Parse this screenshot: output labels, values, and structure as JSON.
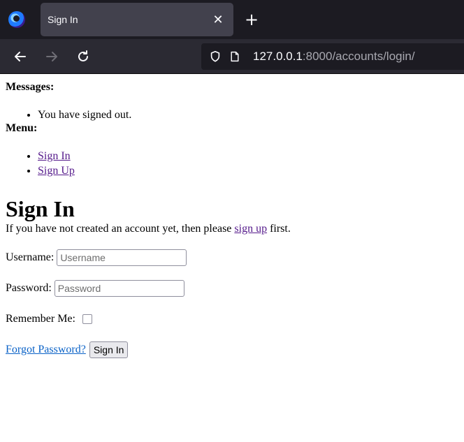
{
  "browser": {
    "tab": {
      "title": "Sign In",
      "close_icon": "close-icon"
    },
    "new_tab_icon": "plus-icon",
    "nav": {
      "back_icon": "back-arrow-icon",
      "forward_icon": "forward-arrow-icon",
      "reload_icon": "reload-icon"
    },
    "url": {
      "host": "127.0.0.1",
      "rest": ":8000/accounts/login/"
    }
  },
  "messages": {
    "title": "Messages:",
    "items": [
      "You have signed out."
    ]
  },
  "menu": {
    "title": "Menu:",
    "items": [
      "Sign In",
      "Sign Up"
    ]
  },
  "main": {
    "heading": "Sign In",
    "intro_before": "If you have not created an account yet, then please ",
    "intro_link": "sign up",
    "intro_after": " first.",
    "username_label": "Username:",
    "username_placeholder": "Username",
    "username_value": "",
    "password_label": "Password:",
    "password_placeholder": "Password",
    "password_value": "",
    "remember_label": "Remember Me:",
    "remember_checked": false,
    "forgot_link": "Forgot Password?",
    "submit_label": "Sign In"
  }
}
